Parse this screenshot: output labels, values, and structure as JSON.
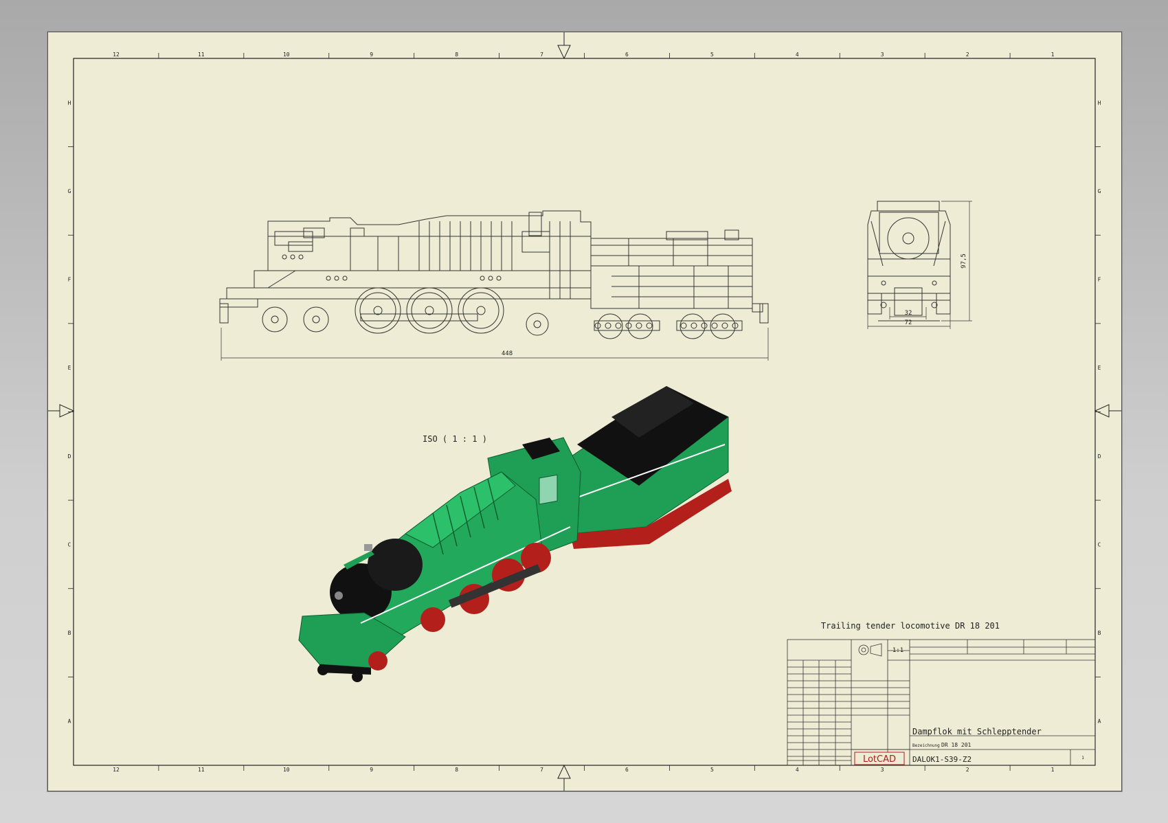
{
  "drawing": {
    "title_note": "Trailing tender locomotive DR 18 201",
    "iso_label": "ISO ( 1 : 1 )",
    "dimensions": {
      "length": "448",
      "height": "97,5",
      "width_inner": "32",
      "width_outer": "72"
    },
    "column_labels": [
      "12",
      "11",
      "10",
      "9",
      "8",
      "7",
      "6",
      "5",
      "4",
      "3",
      "2",
      "1"
    ],
    "row_labels": [
      "H",
      "G",
      "F",
      "E",
      "D",
      "C",
      "B",
      "A"
    ]
  },
  "title_block": {
    "name": "Dampflok mit Schlepptender",
    "subtitle_label": "Bezeichnung",
    "subtitle": "DR 18 201",
    "logo": "LotCAD",
    "drawing_number": "DALOK1-S39-Z2",
    "scale": "1:1",
    "sheet": "1"
  },
  "colors": {
    "paper": "#eeecd5",
    "line": "#222222",
    "loco_green": "#1f9e55",
    "loco_black": "#111111",
    "loco_red": "#b3201c",
    "logo_red": "#b31b1b"
  }
}
